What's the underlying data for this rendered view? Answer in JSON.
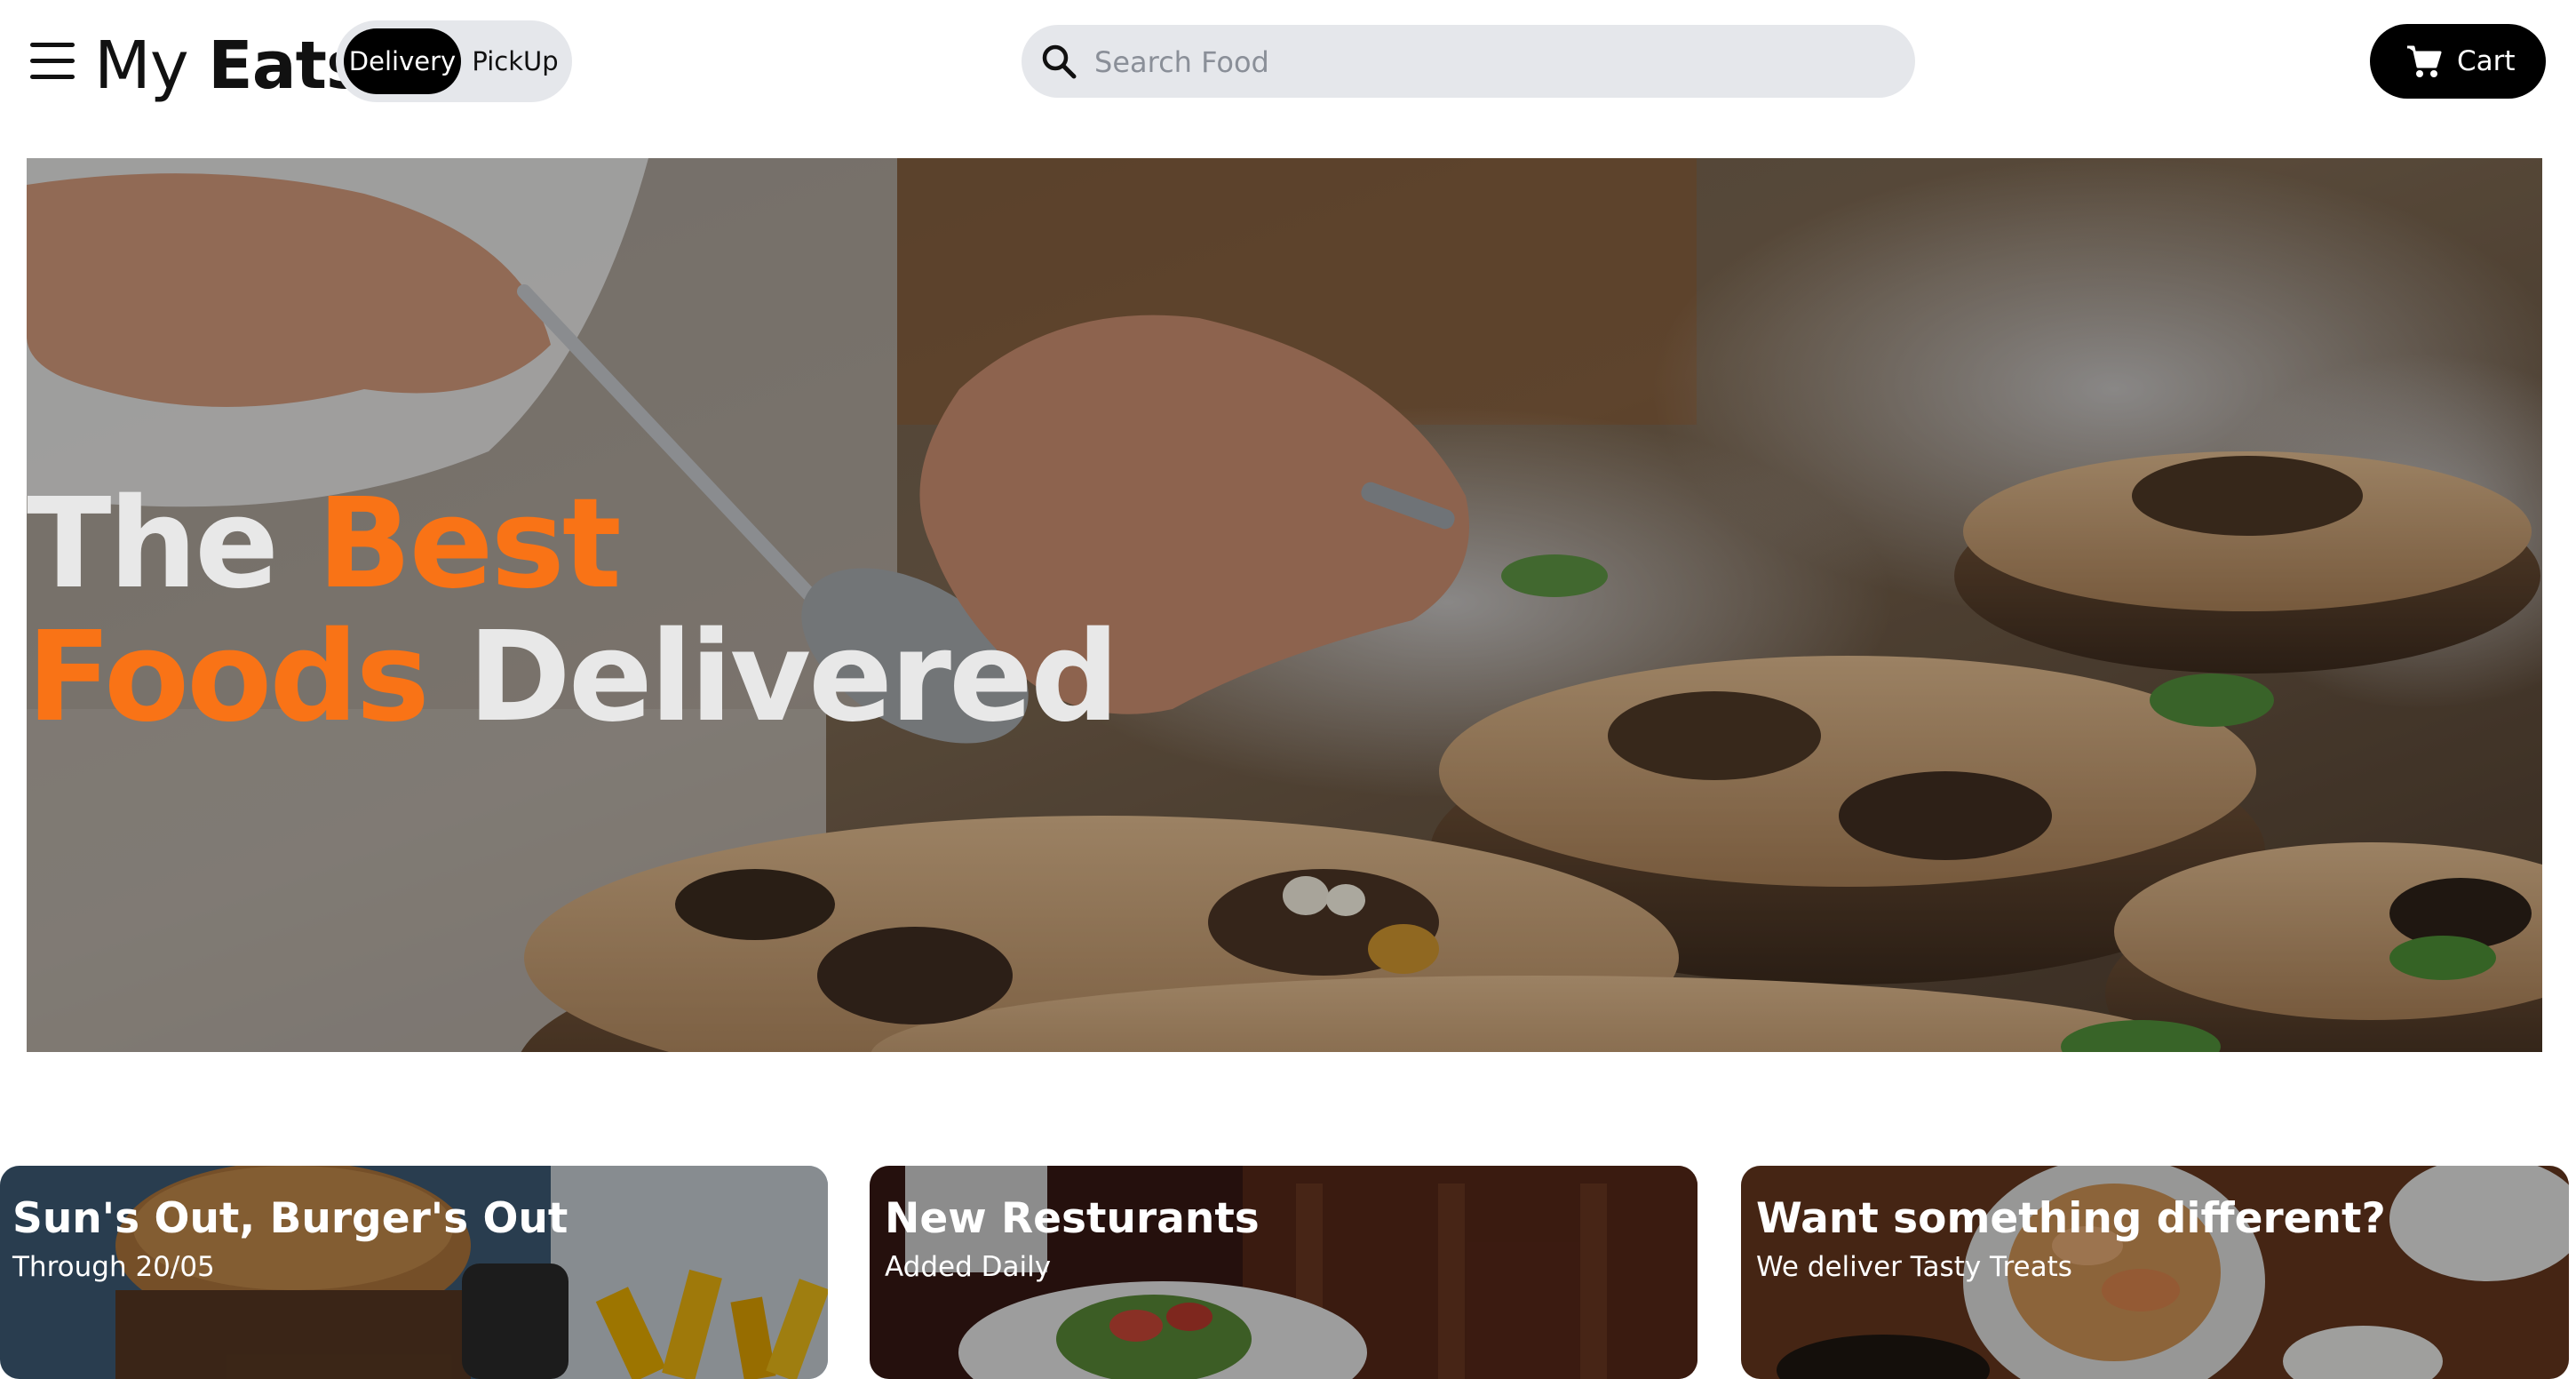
{
  "header": {
    "logo": {
      "prefix": "My",
      "strong": "Eats"
    },
    "mode_toggle": {
      "delivery_label": "Delivery",
      "pickup_label": "PickUp",
      "selected": "Delivery"
    },
    "search": {
      "placeholder": "Search Food",
      "value": ""
    },
    "cart_label": "Cart",
    "icons": {
      "menu": "hamburger-menu-icon",
      "search": "search-icon",
      "cart": "cart-icon"
    }
  },
  "hero": {
    "line1": {
      "text": "The",
      "accent": "Best"
    },
    "line2": {
      "accent": "Foods",
      "text": "Delivered"
    },
    "accent_color": "#f97316"
  },
  "promos": [
    {
      "title": "Sun's Out, Burger's Out",
      "subtitle": "Through 20/05"
    },
    {
      "title": "New Resturants",
      "subtitle": "Added Daily"
    },
    {
      "title": "Want something different?",
      "subtitle": "We deliver Tasty Treats"
    }
  ]
}
